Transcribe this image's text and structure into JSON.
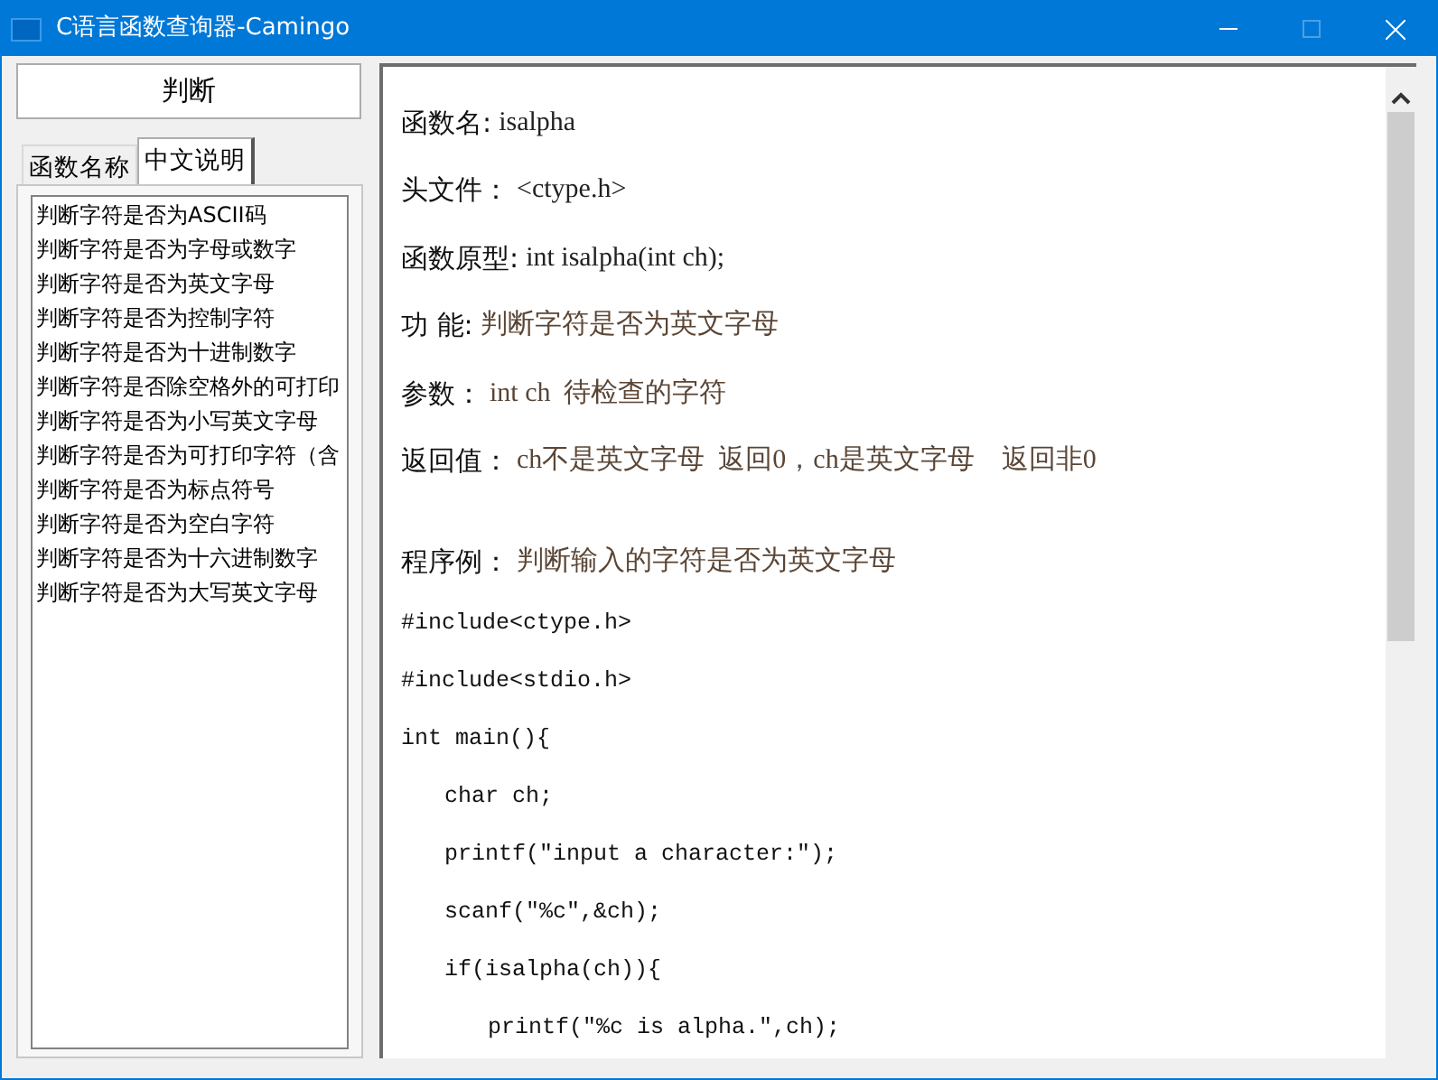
{
  "window": {
    "title": "C语言函数查询器-Camingo"
  },
  "search": {
    "value": "判断"
  },
  "tabs": [
    {
      "label": "函数名称",
      "selected": false
    },
    {
      "label": "中文说明",
      "selected": true
    }
  ],
  "results": [
    "判断字符是否为ASCII码",
    "判断字符是否为字母或数字",
    "判断字符是否为英文字母",
    "判断字符是否为控制字符",
    "判断字符是否为十进制数字",
    "判断字符是否除空格外的可打印",
    "判断字符是否为小写英文字母",
    "判断字符是否为可打印字符（含",
    "判断字符是否为标点符号",
    "判断字符是否为空白字符",
    "判断字符是否为十六进制数字",
    "判断字符是否为大写英文字母"
  ],
  "detail": {
    "fields": [
      {
        "label": "函数名:",
        "value": "isalpha"
      },
      {
        "label": "头文件：",
        "value": "<ctype.h>"
      },
      {
        "label": "函数原型:",
        "value": "int isalpha(int ch);"
      },
      {
        "label": "功  能:",
        "value": "判断字符是否为英文字母"
      },
      {
        "label": "参数：",
        "value": "int ch  待检查的字符"
      },
      {
        "label": "返回值：",
        "value": "ch不是英文字母  返回0，ch是英文字母    返回非0"
      }
    ],
    "example": {
      "label": "程序例：",
      "value": "判断输入的字符是否为英文字母"
    },
    "code": [
      {
        "text": "#include<ctype.h>"
      },
      {
        "text": "#include<stdio.h>"
      },
      {
        "text": "int main(){",
        "children": [
          {
            "text": "char ch;"
          },
          {
            "text": "printf(\"input a character:\");"
          },
          {
            "text": "scanf(\"%c\",&ch);"
          },
          {
            "text": "if(isalpha(ch)){",
            "children": [
              {
                "text": "printf(\"%c is alpha.\",ch);"
              }
            ]
          }
        ]
      }
    ]
  }
}
